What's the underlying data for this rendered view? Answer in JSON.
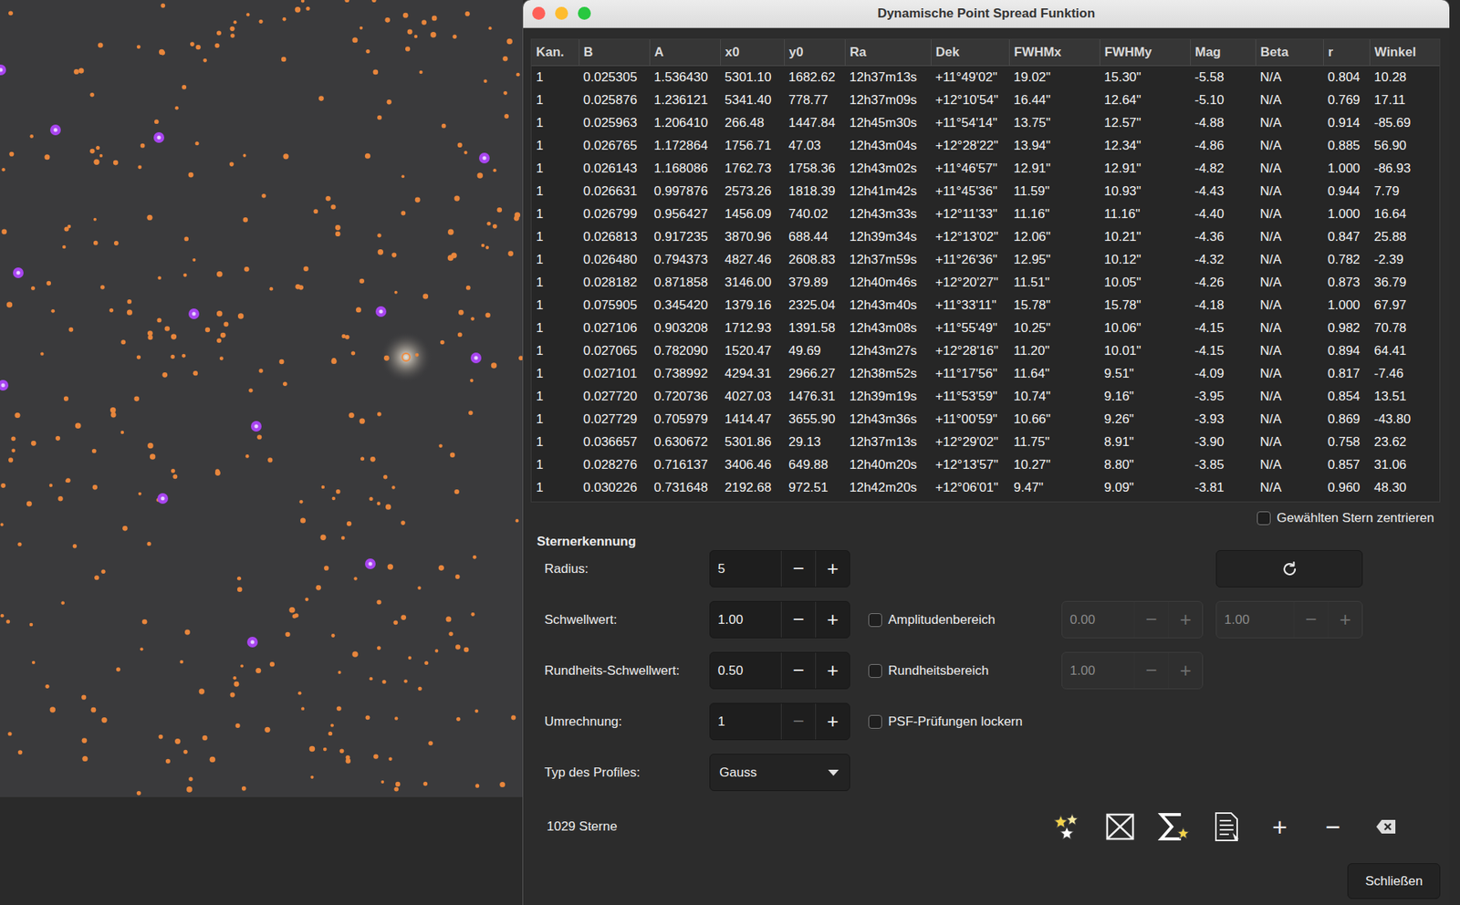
{
  "window": {
    "title": "Dynamische Point Spread Funktion"
  },
  "table": {
    "columns": [
      "Kan.",
      "B",
      "A",
      "x0",
      "y0",
      "Ra",
      "Dek",
      "FWHMx",
      "FWHMy",
      "Mag",
      "Beta",
      "r",
      "Winkel"
    ],
    "rows": [
      [
        "1",
        "0.025305",
        "1.536430",
        "5301.10",
        "1682.62",
        "12h37m13s",
        "+11°49'02\"",
        "19.02\"",
        "15.30\"",
        "-5.58",
        "N/A",
        "0.804",
        "10.28"
      ],
      [
        "1",
        "0.025876",
        "1.236121",
        "5341.40",
        "778.77",
        "12h37m09s",
        "+12°10'54\"",
        "16.44\"",
        "12.64\"",
        "-5.10",
        "N/A",
        "0.769",
        "17.11"
      ],
      [
        "1",
        "0.025963",
        "1.206410",
        "266.48",
        "1447.84",
        "12h45m30s",
        "+11°54'14\"",
        "13.75\"",
        "12.57\"",
        "-4.88",
        "N/A",
        "0.914",
        "-85.69"
      ],
      [
        "1",
        "0.026765",
        "1.172864",
        "1756.71",
        "47.03",
        "12h43m04s",
        "+12°28'22\"",
        "13.94\"",
        "12.34\"",
        "-4.86",
        "N/A",
        "0.885",
        "56.90"
      ],
      [
        "1",
        "0.026143",
        "1.168086",
        "1762.73",
        "1758.36",
        "12h43m02s",
        "+11°46'57\"",
        "12.91\"",
        "12.91\"",
        "-4.82",
        "N/A",
        "1.000",
        "-86.93"
      ],
      [
        "1",
        "0.026631",
        "0.997876",
        "2573.26",
        "1818.39",
        "12h41m42s",
        "+11°45'36\"",
        "11.59\"",
        "10.93\"",
        "-4.43",
        "N/A",
        "0.944",
        "7.79"
      ],
      [
        "1",
        "0.026799",
        "0.956427",
        "1456.09",
        "740.02",
        "12h43m33s",
        "+12°11'33\"",
        "11.16\"",
        "11.16\"",
        "-4.40",
        "N/A",
        "1.000",
        "16.64"
      ],
      [
        "1",
        "0.026813",
        "0.917235",
        "3870.96",
        "688.44",
        "12h39m34s",
        "+12°13'02\"",
        "12.06\"",
        "10.21\"",
        "-4.36",
        "N/A",
        "0.847",
        "25.88"
      ],
      [
        "1",
        "0.026480",
        "0.794373",
        "4827.46",
        "2608.83",
        "12h37m59s",
        "+11°26'36\"",
        "12.95\"",
        "10.12\"",
        "-4.32",
        "N/A",
        "0.782",
        "-2.39"
      ],
      [
        "1",
        "0.028182",
        "0.871858",
        "3146.00",
        "379.89",
        "12h40m46s",
        "+12°20'27\"",
        "11.51\"",
        "10.05\"",
        "-4.26",
        "N/A",
        "0.873",
        "36.79"
      ],
      [
        "1",
        "0.075905",
        "0.345420",
        "1379.16",
        "2325.04",
        "12h43m40s",
        "+11°33'11\"",
        "15.78\"",
        "15.78\"",
        "-4.18",
        "N/A",
        "1.000",
        "67.97"
      ],
      [
        "1",
        "0.027106",
        "0.903208",
        "1712.93",
        "1391.58",
        "12h43m08s",
        "+11°55'49\"",
        "10.25\"",
        "10.06\"",
        "-4.15",
        "N/A",
        "0.982",
        "70.78"
      ],
      [
        "1",
        "0.027065",
        "0.782090",
        "1520.47",
        "49.69",
        "12h43m27s",
        "+12°28'16\"",
        "11.20\"",
        "10.01\"",
        "-4.15",
        "N/A",
        "0.894",
        "64.41"
      ],
      [
        "1",
        "0.027101",
        "0.738992",
        "4294.31",
        "2966.27",
        "12h38m52s",
        "+11°17'56\"",
        "11.64\"",
        "9.51\"",
        "-4.09",
        "N/A",
        "0.817",
        "-7.46"
      ],
      [
        "1",
        "0.027720",
        "0.720736",
        "4027.03",
        "1476.31",
        "12h39m19s",
        "+11°53'59\"",
        "10.74\"",
        "9.16\"",
        "-3.95",
        "N/A",
        "0.854",
        "13.51"
      ],
      [
        "1",
        "0.027729",
        "0.705979",
        "1414.47",
        "3655.90",
        "12h43m36s",
        "+11°00'59\"",
        "10.66\"",
        "9.26\"",
        "-3.93",
        "N/A",
        "0.869",
        "-43.80"
      ],
      [
        "1",
        "0.036657",
        "0.630672",
        "5301.86",
        "29.13",
        "12h37m13s",
        "+12°29'02\"",
        "11.75\"",
        "8.91\"",
        "-3.90",
        "N/A",
        "0.758",
        "23.62"
      ],
      [
        "1",
        "0.028276",
        "0.716137",
        "3406.46",
        "649.88",
        "12h40m20s",
        "+12°13'57\"",
        "10.27\"",
        "8.80\"",
        "-3.85",
        "N/A",
        "0.857",
        "31.06"
      ],
      [
        "1",
        "0.030226",
        "0.731648",
        "2192.68",
        "972.51",
        "12h42m20s",
        "+12°06'01\"",
        "9.47\"",
        "9.09\"",
        "-3.81",
        "N/A",
        "0.960",
        "48.30"
      ]
    ]
  },
  "center_star": {
    "label": "Gewählten Stern zentrieren",
    "checked": false
  },
  "spin": {
    "minus": "−",
    "plus": "+"
  },
  "detection": {
    "title": "Sternerkennung",
    "rows": [
      {
        "label": "Radius:",
        "field": {
          "kind": "spin",
          "value": "5",
          "minus_disabled": false
        },
        "aside": {
          "kind": "refresh",
          "label": "",
          "checked": false,
          "fields": []
        }
      },
      {
        "label": "Schwellwert:",
        "field": {
          "kind": "spin",
          "value": "1.00",
          "minus_disabled": false
        },
        "aside": {
          "kind": "range",
          "label": "Amplitudenbereich",
          "checked": false,
          "fields": [
            {
              "value": "0.00",
              "disabled": true
            },
            {
              "value": "1.00",
              "disabled": true
            }
          ]
        }
      },
      {
        "label": "Rundheits-Schwellwert:",
        "field": {
          "kind": "spin",
          "value": "0.50",
          "minus_disabled": false
        },
        "aside": {
          "kind": "range",
          "label": "Rundheitsbereich",
          "checked": false,
          "fields": [
            {
              "value": "1.00",
              "disabled": true
            }
          ]
        }
      },
      {
        "label": "Umrechnung:",
        "field": {
          "kind": "spin",
          "value": "1",
          "minus_disabled": true
        },
        "aside": {
          "kind": "range",
          "label": "PSF-Prüfungen lockern",
          "checked": false,
          "fields": []
        }
      },
      {
        "label": "Typ des Profiles:",
        "field": {
          "kind": "dropdown",
          "value": "Gauss",
          "minus_disabled": false
        },
        "aside": {
          "kind": "none",
          "label": "",
          "checked": false,
          "fields": []
        }
      }
    ]
  },
  "footer": {
    "count": "1029 Sterne",
    "add": "+",
    "remove": "−"
  },
  "buttons": [
    "Schließen"
  ]
}
